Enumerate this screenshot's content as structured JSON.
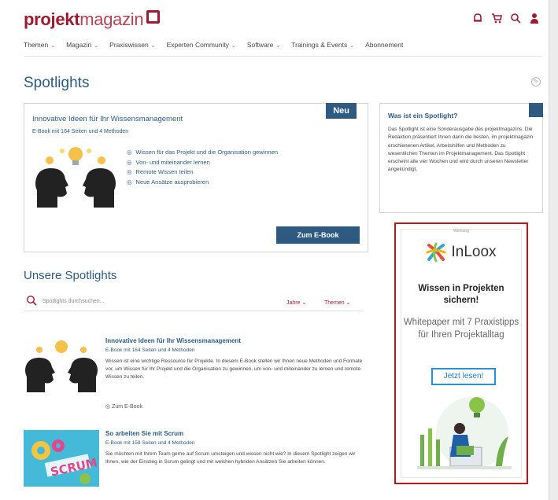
{
  "header": {
    "logo_bold": "projekt",
    "logo_light": "magazin",
    "icons": [
      "notification-icon",
      "cart-icon",
      "search-icon",
      "user-icon"
    ]
  },
  "nav": [
    {
      "label": "Themen",
      "chevron": "⌄"
    },
    {
      "label": "Magazin",
      "chevron": "⌄"
    },
    {
      "label": "Praxiswissen",
      "chevron": "⌄"
    },
    {
      "label": "Experten Community",
      "chevron": "⌄"
    },
    {
      "label": "Software",
      "chevron": "⌄"
    },
    {
      "label": "Trainings & Events",
      "chevron": "⌄"
    },
    {
      "label": "Abonnement",
      "chevron": ""
    }
  ],
  "page_title": "Spotlights",
  "feature": {
    "badge": "Neu",
    "title": "Innovative Ideen für Ihr Wissensmanagement",
    "subtitle": "E-Book mit 164 Seiten und 4 Methoden",
    "bullets": [
      "Wissen für das Projekt und die Organisation gewinnen",
      "Von- und miteinander lernen",
      "Remote Wissen teilen",
      "Neue Ansätze ausprobieren"
    ],
    "button": "Zum E-Book"
  },
  "what_is": {
    "title": "Was ist ein Spotlight?",
    "body": "Das Spotlight ist eine Sonderausgabe des projektmagazins. Die Redaktion präsentiert Ihnen darin die besten, im projektmagazin erschienenen Artikel, Arbeitshilfen und Methoden zu wesentlichen Themen im Projektmanagement. Das Spotlight erscheint alle vier Wochen und wird durch unseren Newsletter angekündigt."
  },
  "ad": {
    "label": "Werbung",
    "brand": "InLoox",
    "headline": "Wissen in Projekten sichern!",
    "text": "Whitepaper mit 7 Praxistipps für Ihren Projektalltag",
    "cta": "Jetzt lesen!",
    "colors": {
      "border": "#c0151b",
      "cta": "#2a8fd4"
    }
  },
  "section_title": "Unsere Spotlights",
  "search": {
    "placeholder": "Spotlights durchsuchen...",
    "filter_year": "Jahre ⌄",
    "filter_topic": "Themen ⌄"
  },
  "articles": [
    {
      "title": "Innovative Ideen für Ihr Wissensmanagement",
      "subtitle": "E-Book mit 164 Seiten und 4 Methoden",
      "body": "Wissen ist eine wichtige Ressource für Projekte. In diesem E-Book stellen wir Ihnen neue Methoden und Formate vor, um Wissen für Ihr Projekt und die Organisation zu gewinnen, um von- und miteinander zu lernen und remote Wissen zu teilen.",
      "link": "Zum E-Book"
    },
    {
      "title": "So arbeiten Sie mit Scrum",
      "subtitle": "E-Book mit 158 Seiten und 4 Methoden",
      "body": "Sie möchten mit Ihrem Team gerne auf Scrum umsteigen und wissen nicht wie? In diesem Spotlight zeigen wir Ihnen, wie der Einstieg in Scrum gelingt und mit welchen hybriden Ansätzen Sie arbeiten können.",
      "link": ""
    }
  ],
  "colors": {
    "brand": "#9b1c31",
    "primary": "#2e5a82"
  }
}
